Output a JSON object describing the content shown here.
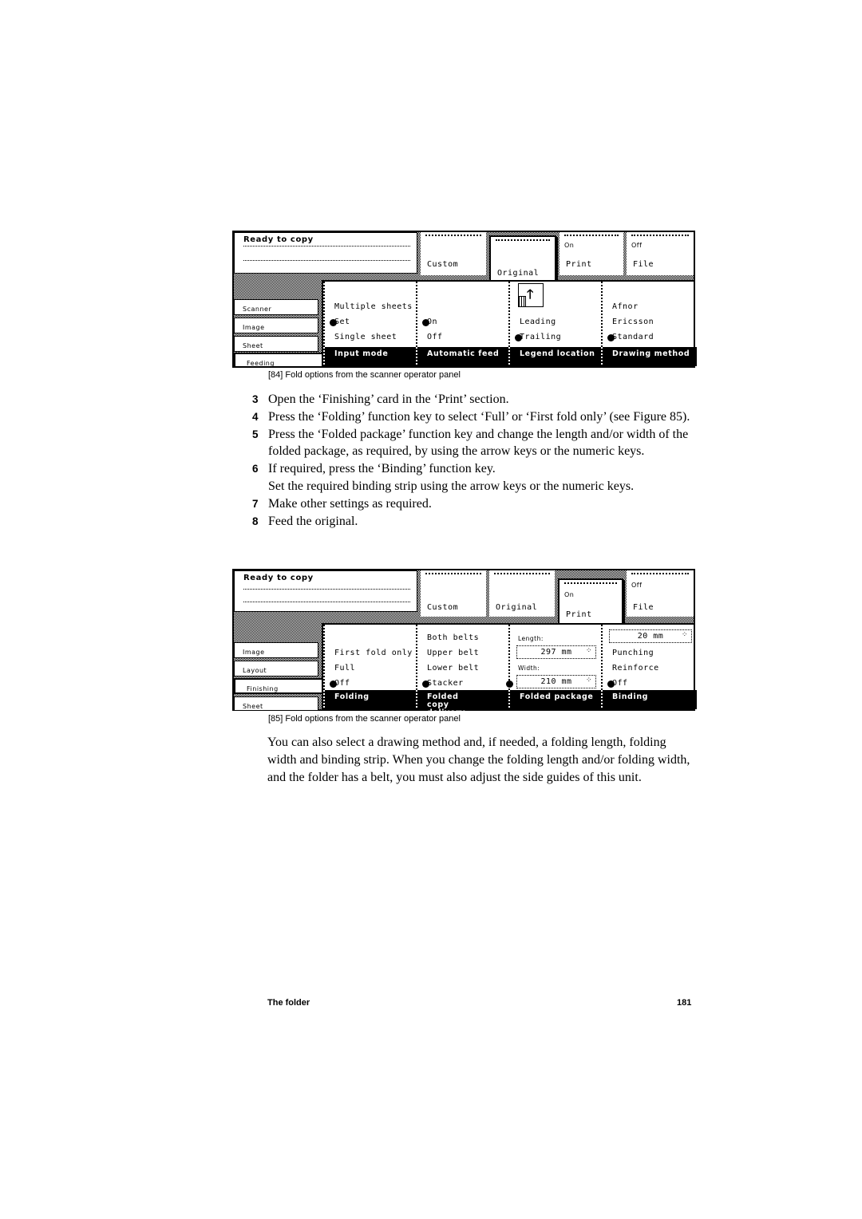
{
  "figure84": {
    "status_title": "Ready to copy",
    "top_cards": [
      {
        "small": "",
        "label": "Custom",
        "selected": false
      },
      {
        "small": "",
        "label": "Original",
        "selected": true
      },
      {
        "small": "On",
        "label": "Print",
        "selected": false
      },
      {
        "small": "Off",
        "label": "File",
        "selected": false
      }
    ],
    "side_tabs": [
      "Scanner",
      "Image",
      "Sheet",
      "Feeding"
    ],
    "selected_side_tab": "Feeding",
    "columns": [
      {
        "options": [
          "Multiple sheets",
          "Set",
          "Single sheet"
        ],
        "selected": "Set",
        "function_key": "Input mode"
      },
      {
        "options": [
          "On",
          "Off"
        ],
        "selected": "On",
        "function_key": "Automatic feed"
      },
      {
        "icon": "legend-location-icon",
        "options": [
          "Leading",
          "Trailing"
        ],
        "selected": "Trailing",
        "function_key": "Legend location"
      },
      {
        "options": [
          "Afnor",
          "Ericsson",
          "Standard"
        ],
        "selected": "Standard",
        "function_key": "Drawing method"
      }
    ],
    "caption": "[84] Fold options from the scanner operator panel"
  },
  "steps": [
    {
      "n": "3",
      "text": "Open the ‘Finishing’ card in the ‘Print’ section."
    },
    {
      "n": "4",
      "text": "Press the ‘Folding’ function key to select ‘Full’ or ‘First fold only’ (see Figure 85)."
    },
    {
      "n": "5",
      "text": "Press the ‘Folded package’ function key and change the length and/or width of the folded package, as required, by using the arrow keys or the numeric keys."
    },
    {
      "n": "6",
      "text": "If required, press the ‘Binding’ function key.",
      "sub": "Set the required binding strip using the arrow keys or the numeric keys."
    },
    {
      "n": "7",
      "text": "Make other settings as required."
    },
    {
      "n": "8",
      "text": "Feed the original."
    }
  ],
  "figure85": {
    "status_title": "Ready to copy",
    "top_cards": [
      {
        "small": "",
        "label": "Custom",
        "selected": false
      },
      {
        "small": "",
        "label": "Original",
        "selected": false
      },
      {
        "small": "On",
        "label": "Print",
        "selected": true
      },
      {
        "small": "Off",
        "label": "File",
        "selected": false
      }
    ],
    "side_tabs": [
      "Image",
      "Layout",
      "Finishing",
      "Sheet"
    ],
    "selected_side_tab": "Finishing",
    "folding": {
      "options": [
        "First fold only",
        "Full",
        "Off"
      ],
      "selected": "Off",
      "function_key": "Folding"
    },
    "folded_copy": {
      "options": [
        "Both belts",
        "Upper belt",
        "Lower belt",
        "Stacker"
      ],
      "selected": "Stacker",
      "function_key": "Folded copy delivery"
    },
    "folded_package": {
      "length_label": "Length:",
      "length_value": "297 mm",
      "width_label": "Width:",
      "width_value": "210 mm",
      "selected": "Width",
      "function_key": "Folded package"
    },
    "binding": {
      "strip_value": "20 mm",
      "options": [
        "Punching",
        "Reinforce",
        "Off"
      ],
      "selected": "Off",
      "function_key": "Binding"
    },
    "caption": "[85] Fold options from the scanner operator panel"
  },
  "paragraph": "You can also select a drawing method and, if needed, a folding length, folding width and binding strip. When you change the folding length and/or folding width, and the folder has a belt, you must also adjust the side guides of this unit.",
  "footer": {
    "section": "The folder",
    "page": "181"
  },
  "icons": {
    "spin": "⁘"
  }
}
